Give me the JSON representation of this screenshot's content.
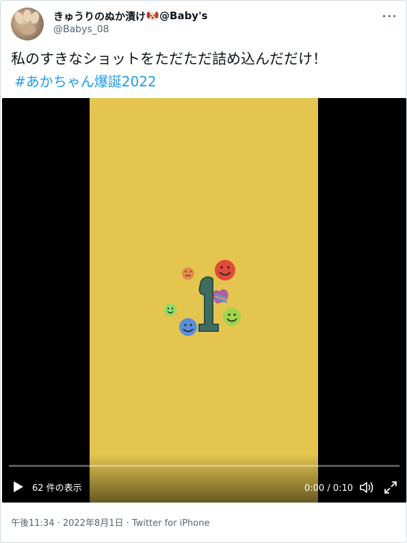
{
  "author": {
    "display_name": "きゅうりのぬか漬け",
    "display_suffix": "@Baby's",
    "handle": "@Babys_08",
    "avatar_icon": "user-avatar-icon",
    "emoji_icon": "dog-face-icon"
  },
  "tweet": {
    "text": "私のすきなショットをただただ詰め込んだだけ！",
    "hashtag": "#あかちゃん爆誕2022"
  },
  "video": {
    "view_count": "62 件の表示",
    "time": "0:00 / 0:10",
    "progress": 0,
    "background_color": "#e3c54f",
    "play_icon": "play-icon",
    "volume_icon": "volume-icon",
    "fullscreen_icon": "fullscreen-icon"
  },
  "meta": {
    "line": "午後11:34 · 2022年8月1日 · Twitter for iPhone"
  },
  "colors": {
    "link": "#1d9bf0",
    "secondary_text": "#536471"
  }
}
